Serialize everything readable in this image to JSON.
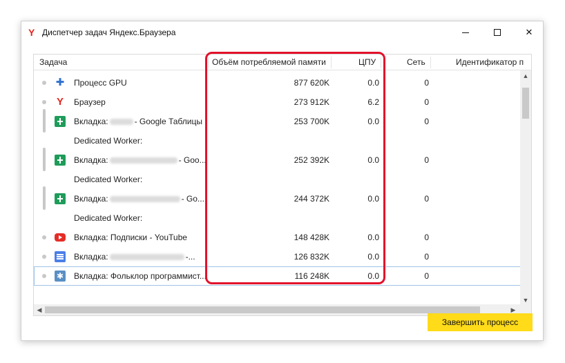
{
  "window": {
    "title": "Диспетчер задач Яндекс.Браузера",
    "app_icon": "Y"
  },
  "columns": {
    "task": "Задача",
    "memory": "Объём потребляемой памяти",
    "cpu": "ЦПУ",
    "network": "Сеть",
    "pid": "Идентификатор п"
  },
  "rows": [
    {
      "icon": "puzzle-icon",
      "name": "Процесс GPU",
      "memory": "877 620K",
      "cpu": "0.0",
      "network": "0"
    },
    {
      "icon": "yandex-icon",
      "name": "Браузер",
      "memory": "273 912K",
      "cpu": "6.2",
      "network": "0"
    },
    {
      "icon": "sheets-icon",
      "name_prefix": "Вкладка:",
      "name_suffix": "- Google Таблицы",
      "memory": "253 700K",
      "cpu": "0.0",
      "network": "0"
    },
    {
      "name": "Dedicated Worker:"
    },
    {
      "icon": "sheets-icon",
      "name_prefix": "Вкладка:",
      "name_suffix": "- Goo...",
      "memory": "252 392K",
      "cpu": "0.0",
      "network": "0"
    },
    {
      "name": "Dedicated Worker:"
    },
    {
      "icon": "sheets-icon",
      "name_prefix": "Вкладка:",
      "name_suffix": "- Go...",
      "memory": "244 372K",
      "cpu": "0.0",
      "network": "0"
    },
    {
      "name": "Dedicated Worker:"
    },
    {
      "icon": "youtube-icon",
      "name": "Вкладка: Подписки - YouTube",
      "memory": "148 428K",
      "cpu": "0.0",
      "network": "0"
    },
    {
      "icon": "docs-icon",
      "name_prefix": "Вкладка:",
      "name_suffix": "-...",
      "memory": "126 832K",
      "cpu": "0.0",
      "network": "0"
    },
    {
      "icon": "site-favicon-icon",
      "name": "Вкладка: Фольклор программист...",
      "memory": "116 248K",
      "cpu": "0.0",
      "network": "0"
    }
  ],
  "buttons": {
    "end_process": "Завершить процесс"
  },
  "colors": {
    "accent_button": "#ffdb1a",
    "highlight_frame": "#e2112a"
  }
}
